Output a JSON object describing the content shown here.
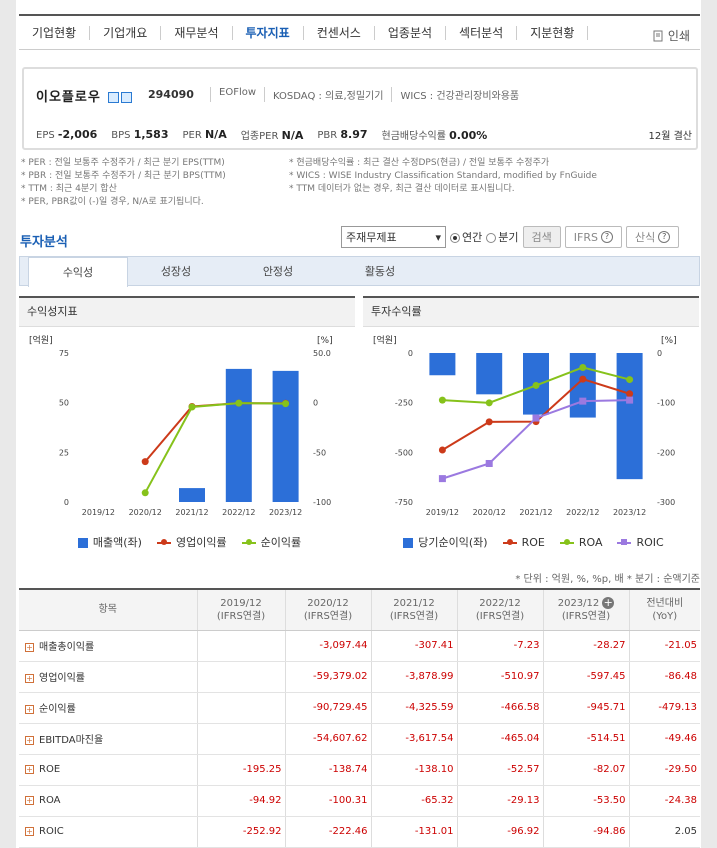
{
  "nav": {
    "items": [
      "기업현황",
      "기업개요",
      "재무분석",
      "투자지표",
      "컨센서스",
      "업종분석",
      "섹터분석",
      "지분현황"
    ],
    "active_index": 3,
    "print_label": "인쇄"
  },
  "company": {
    "name": "이오플로우",
    "code": "294090",
    "english_name": "EOFlow",
    "market": "KOSDAQ : 의료,정밀기기",
    "wics": "WICS : 건강관리장비와용품",
    "stats": [
      {
        "label": "EPS",
        "value": "-2,006"
      },
      {
        "label": "BPS",
        "value": "1,583"
      },
      {
        "label": "PER",
        "value": "N/A"
      },
      {
        "label": "업종PER",
        "value": "N/A"
      },
      {
        "label": "PBR",
        "value": "8.97"
      },
      {
        "label": "현금배당수익률",
        "value": "0.00%"
      }
    ],
    "fiscal": "12월 결산"
  },
  "notes": {
    "left": [
      "* PER : 전일 보통주 수정주가 / 최근 분기 EPS(TTM)",
      "* PBR : 전일 보통주 수정주가 / 최근 분기 BPS(TTM)",
      "* TTM : 최근 4분기 합산",
      "* PER, PBR값이 (-)일 경우, N/A로 표기됩니다."
    ],
    "right": [
      "* 현금배당수익률 : 최근 결산 수정DPS(현금) / 전일 보통주 수정주가",
      "* WICS : WISE Industry Classification Standard, modified by FnGuide",
      "* TTM 데이터가 없는 경우, 최근 결산 데이터로 표시됩니다."
    ]
  },
  "section": {
    "title": "투자분석",
    "select_value": "주재무제표",
    "radio_annual": "연간",
    "radio_quarter": "분기",
    "search_button": "검색",
    "ifrs_button": "IFRS",
    "formula_button": "산식"
  },
  "tabs": [
    "수익성",
    "성장성",
    "안정성",
    "활동성"
  ],
  "active_tab": 0,
  "chart_data": [
    {
      "type": "bar",
      "title": "수익성지표",
      "ylabel_left": "[억원]",
      "ylabel_right": "[%]",
      "categories": [
        "2019/12",
        "2020/12",
        "2021/12",
        "2022/12",
        "2023/12"
      ],
      "ylim_left": [
        0,
        75
      ],
      "ylim_right": [
        -100,
        50
      ],
      "left_ticks": [
        "75",
        "50",
        "25",
        "0"
      ],
      "right_ticks": [
        "50.0",
        "0",
        "-50",
        "-100"
      ],
      "series": [
        {
          "name": "매출액(좌)",
          "kind": "bar",
          "axis": "left",
          "color": "#2c6fd8",
          "values": [
            0,
            0,
            7,
            67,
            66
          ]
        },
        {
          "name": "영업이익률",
          "kind": "line",
          "axis": "right",
          "color": "#cc3a1a",
          "values": [
            null,
            -59.38,
            -3.88,
            -0.51,
            -0.6
          ]
        },
        {
          "name": "순이익률",
          "kind": "line",
          "axis": "right",
          "color": "#86c21b",
          "values": [
            null,
            -90.73,
            -4.33,
            -0.47,
            -0.95
          ]
        }
      ]
    },
    {
      "type": "bar",
      "title": "투자수익률",
      "ylabel_left": "[억원]",
      "ylabel_right": "[%]",
      "categories": [
        "2019/12",
        "2020/12",
        "2021/12",
        "2022/12",
        "2023/12"
      ],
      "ylim_left": [
        -750,
        0
      ],
      "ylim_right": [
        -300,
        0
      ],
      "left_ticks": [
        "0",
        "-250",
        "-500",
        "-750"
      ],
      "right_ticks": [
        "0",
        "-100",
        "-200",
        "-300"
      ],
      "series": [
        {
          "name": "당기순이익(좌)",
          "kind": "bar",
          "axis": "left",
          "color": "#2c6fd8",
          "values": [
            -112,
            -208,
            -310,
            -325,
            -635
          ]
        },
        {
          "name": "ROE",
          "kind": "line",
          "axis": "right",
          "color": "#cc3a1a",
          "values": [
            -195.25,
            -138.74,
            -138.1,
            -52.57,
            -82.07
          ]
        },
        {
          "name": "ROA",
          "kind": "line",
          "axis": "right",
          "color": "#86c21b",
          "values": [
            -94.92,
            -100.31,
            -65.32,
            -29.13,
            -53.5
          ]
        },
        {
          "name": "ROIC",
          "kind": "line",
          "axis": "right",
          "color": "#9b79e0",
          "marker": "square",
          "values": [
            -252.92,
            -222.46,
            -131.01,
            -96.92,
            -94.86
          ]
        }
      ]
    }
  ],
  "units_note": "* 단위 : 억원, %, %p, 배      * 분기 : 순액기준",
  "table": {
    "header_item": "항목",
    "columns": [
      {
        "year": "2019/12",
        "basis": "(IFRS연결)"
      },
      {
        "year": "2020/12",
        "basis": "(IFRS연결)"
      },
      {
        "year": "2021/12",
        "basis": "(IFRS연결)"
      },
      {
        "year": "2022/12",
        "basis": "(IFRS연결)"
      },
      {
        "year": "2023/12",
        "basis": "(IFRS연결)"
      },
      {
        "year": "전년대비",
        "basis": "(YoY)"
      }
    ],
    "rows": [
      {
        "label": "매출총이익률",
        "values": [
          "",
          "-3,097.44",
          "-307.41",
          "-7.23",
          "-28.27",
          "-21.05"
        ]
      },
      {
        "label": "영업이익률",
        "values": [
          "",
          "-59,379.02",
          "-3,878.99",
          "-510.97",
          "-597.45",
          "-86.48"
        ]
      },
      {
        "label": "순이익률",
        "values": [
          "",
          "-90,729.45",
          "-4,325.59",
          "-466.58",
          "-945.71",
          "-479.13"
        ]
      },
      {
        "label": "EBITDA마진율",
        "values": [
          "",
          "-54,607.62",
          "-3,617.54",
          "-465.04",
          "-514.51",
          "-49.46"
        ]
      },
      {
        "label": "ROE",
        "values": [
          "-195.25",
          "-138.74",
          "-138.10",
          "-52.57",
          "-82.07",
          "-29.50"
        ]
      },
      {
        "label": "ROA",
        "values": [
          "-94.92",
          "-100.31",
          "-65.32",
          "-29.13",
          "-53.50",
          "-24.38"
        ]
      },
      {
        "label": "ROIC",
        "values": [
          "-252.92",
          "-222.46",
          "-131.01",
          "-96.92",
          "-94.86",
          "2.05"
        ]
      }
    ]
  }
}
